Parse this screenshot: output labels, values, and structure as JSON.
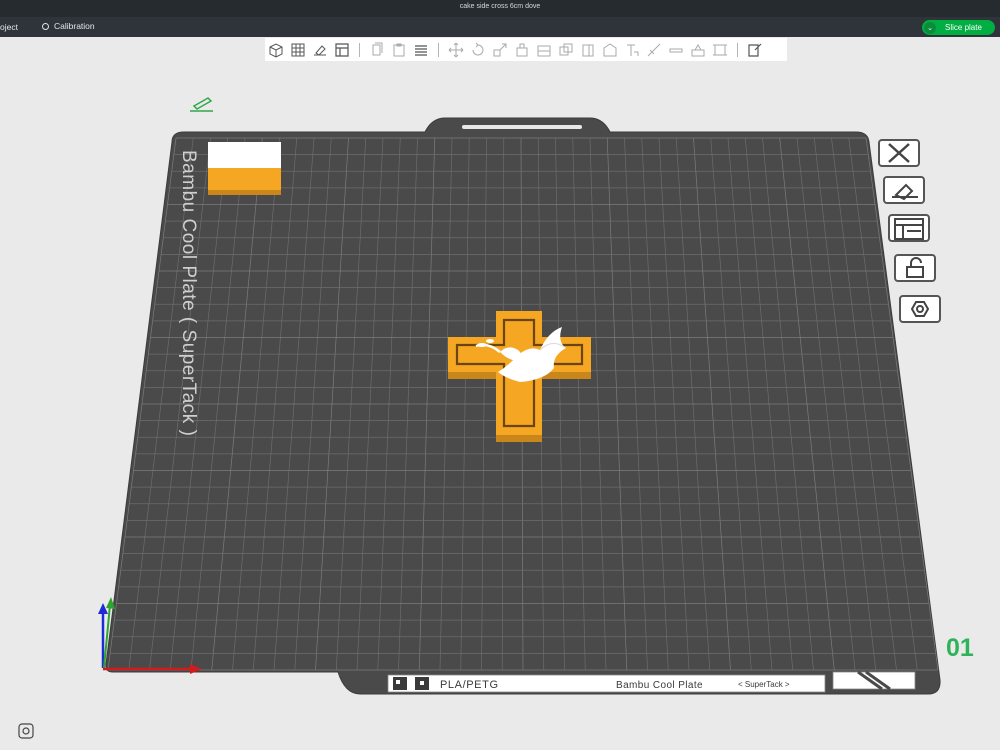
{
  "window": {
    "title": "cake side cross 6cm dove"
  },
  "menu": {
    "project_tab": "oject",
    "calibration_tab": "Calibration"
  },
  "actions": {
    "slice_label": "Slice plate"
  },
  "plate": {
    "number": "01",
    "filament_type": "PLA/PETG",
    "plate_type": "Bambu Cool Plate",
    "plate_subtype": "< SuperTack >",
    "bed_label": "Bambu Cool Plate ( SuperTack )"
  },
  "icons": {
    "toolbar": [
      "add-object-icon",
      "add-plate-icon",
      "auto-orient-icon",
      "arrange-icon",
      "copy-icon",
      "paste-icon",
      "layers-icon",
      "move-icon",
      "rotate-icon",
      "scale-icon",
      "place-on-face-icon",
      "cut-icon",
      "boolean-icon",
      "support-paint-icon",
      "seam-paint-icon",
      "text-icon",
      "measure-icon",
      "emboss-icon",
      "assembly-icon",
      "view-icon"
    ],
    "side": [
      "delete-plate-icon",
      "auto-orient-plate-icon",
      "arrange-plate-icon",
      "lock-plate-icon",
      "plate-settings-icon"
    ]
  },
  "colors": {
    "accent": "#00ae42",
    "model": "#f5a623",
    "bed": "#494949",
    "grid": "#6a6a6a"
  }
}
